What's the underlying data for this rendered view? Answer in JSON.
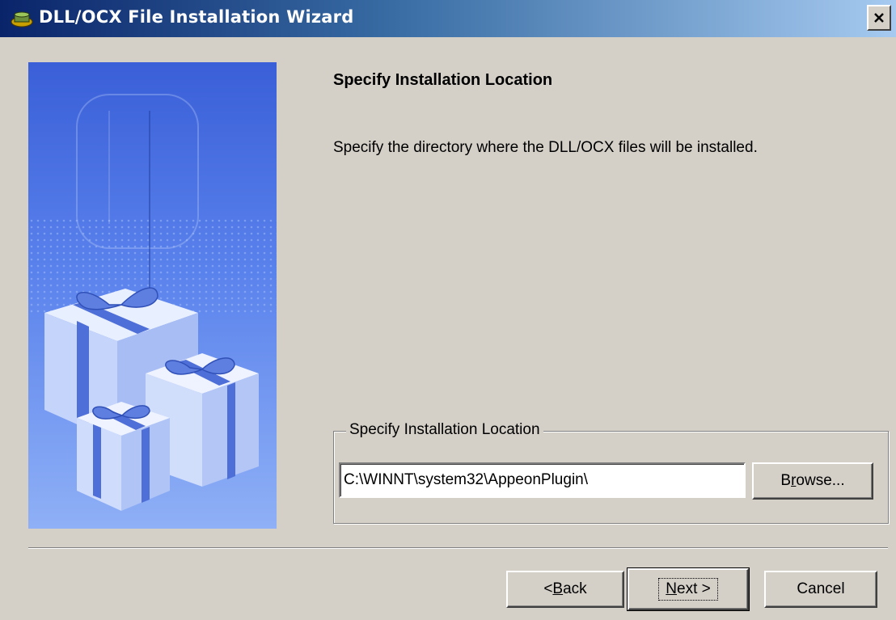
{
  "window": {
    "title": "DLL/OCX File Installation Wizard",
    "title_icon": "installer-icon",
    "close_icon": "close-icon"
  },
  "page": {
    "heading": "Specify Installation Location",
    "description": "Specify the directory where the DLL/OCX files will be installed."
  },
  "location_group": {
    "legend": "Specify Installation Location",
    "path_value": "C:\\WINNT\\system32\\AppeonPlugin\\",
    "browse_label_pre": "B",
    "browse_label_mnemonic": "r",
    "browse_label_post": "owse..."
  },
  "buttons": {
    "back_pre": "< ",
    "back_mnemonic": "B",
    "back_post": "ack",
    "next_mnemonic": "N",
    "next_post": "ext >",
    "cancel": "Cancel"
  },
  "colors": {
    "titlebar_start": "#0a246a",
    "titlebar_end": "#a6caf0",
    "dialog_bg": "#d4d0c8"
  }
}
